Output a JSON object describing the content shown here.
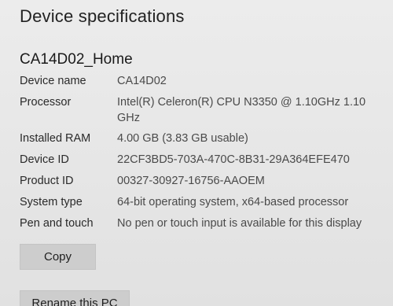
{
  "section": {
    "title": "Device specifications"
  },
  "device": {
    "heading": "CA14D02_Home"
  },
  "specs": [
    {
      "label": "Device name",
      "value": "CA14D02"
    },
    {
      "label": "Processor",
      "value": "Intel(R) Celeron(R) CPU N3350 @ 1.10GHz   1.10 GHz"
    },
    {
      "label": "Installed RAM",
      "value": "4.00 GB (3.83 GB usable)"
    },
    {
      "label": "Device ID",
      "value": "22CF3BD5-703A-470C-8B31-29A364EFE470"
    },
    {
      "label": "Product ID",
      "value": "00327-30927-16756-AAOEM"
    },
    {
      "label": "System type",
      "value": "64-bit operating system, x64-based processor"
    },
    {
      "label": "Pen and touch",
      "value": "No pen or touch input is available for this display"
    }
  ],
  "actions": {
    "copy_label": "Copy",
    "rename_label": "Rename this PC"
  }
}
